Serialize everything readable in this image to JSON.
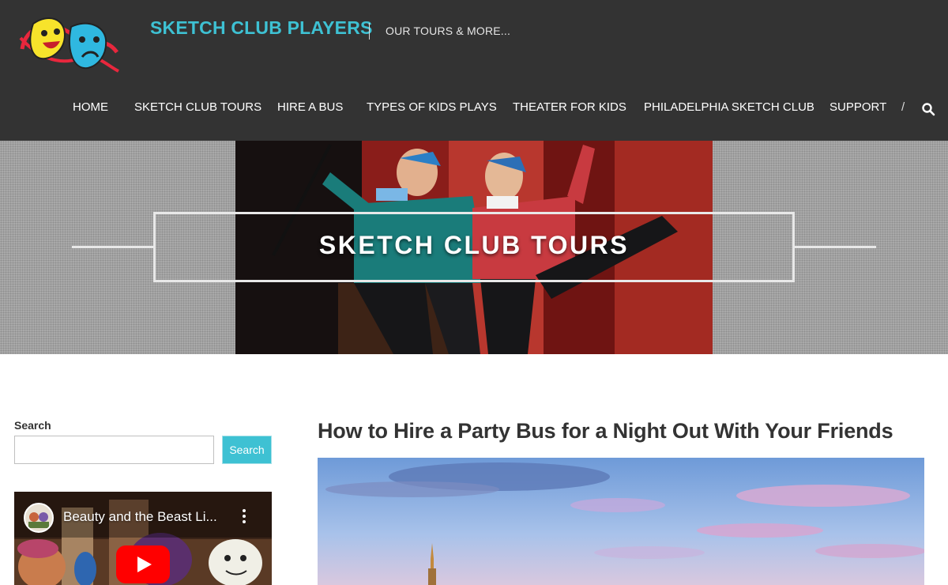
{
  "header": {
    "site_title": "SKETCH CLUB PLAYERS",
    "tagline": "OUR TOURS & MORE...",
    "nav": [
      {
        "label": "HOME"
      },
      {
        "label": "SKETCH CLUB TOURS"
      },
      {
        "label": "HIRE A BUS"
      },
      {
        "label": "TYPES OF KIDS PLAYS"
      },
      {
        "label": "THEATER FOR KIDS"
      },
      {
        "label": "PHILADELPHIA SKETCH CLUB"
      },
      {
        "label": "SUPPORT"
      }
    ],
    "nav_separator": "/",
    "icons": {
      "search": "search-icon",
      "logo": "theater-masks-logo"
    }
  },
  "banner": {
    "title": "SKETCH CLUB TOURS"
  },
  "sidebar": {
    "search_label": "Search",
    "search_value": "",
    "search_button": "Search",
    "video": {
      "title": "Beauty and the Beast Li...",
      "icons": {
        "menu": "more-vertical-icon",
        "play": "play-icon"
      }
    }
  },
  "article": {
    "title": "How to Hire a Party Bus for a Night Out With Your Friends"
  },
  "colors": {
    "header_bg": "#333333",
    "accent": "#3ec1d3",
    "text": "#333333"
  }
}
